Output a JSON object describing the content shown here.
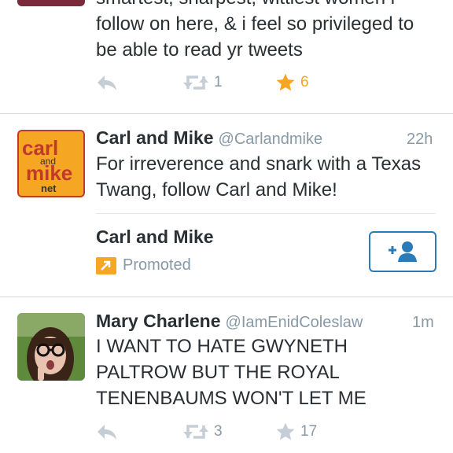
{
  "tweets": [
    {
      "text_lines": [
        "smartest, sharpest, wittiest women i",
        "follow on here, & i feel so privileged to",
        "be able to read yr tweets"
      ],
      "retweet_count": "1",
      "favorite_count": "6"
    },
    {
      "name": "Carl and Mike",
      "handle": "@Carlandmike",
      "time": "22h",
      "text_lines": [
        "For irreverence and snark with a Texas",
        "Twang, follow Carl and Mike!"
      ],
      "avatar_text": {
        "top": "carl",
        "mid": "and",
        "bottom": "mike",
        "sub": "net"
      },
      "promo_name": "Carl and Mike",
      "promo_label": "Promoted"
    },
    {
      "name": "Mary Charlene",
      "handle": "@IamEnidColeslaw",
      "time": "1m",
      "text_lines": [
        "I WANT TO HATE GWYNETH",
        "PALTROW BUT THE ROYAL",
        "TENENBAUMS WON'T LET ME"
      ],
      "retweet_count": "3",
      "favorite_count": "17"
    }
  ],
  "colors": {
    "accent": "#2b7bb9",
    "favorite_active": "#f5a623",
    "meta": "#8899a6"
  },
  "icons": [
    "reply-icon",
    "retweet-icon",
    "star-icon",
    "promoted-arrow-icon",
    "follow-user-icon"
  ]
}
